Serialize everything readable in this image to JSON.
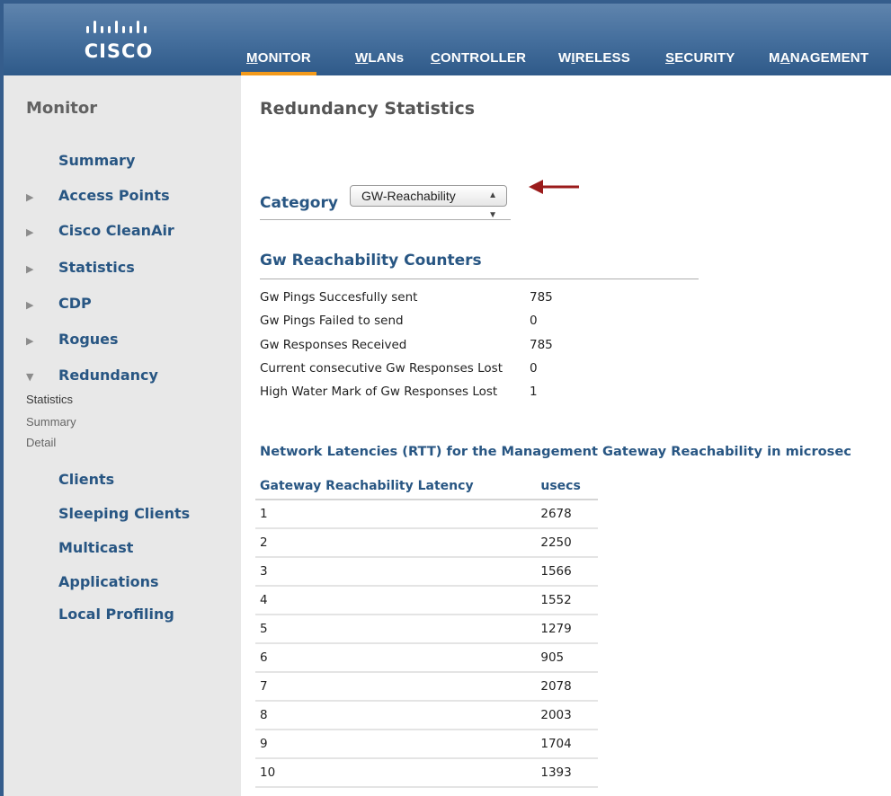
{
  "brand": {
    "logo_text": "CISCO"
  },
  "topnav": {
    "tabs": [
      {
        "pre": "",
        "u": "M",
        "post": "ONITOR",
        "active": true
      },
      {
        "pre": "",
        "u": "W",
        "post": "LANs",
        "active": false
      },
      {
        "pre": "",
        "u": "C",
        "post": "ONTROLLER",
        "active": false
      },
      {
        "pre": "W",
        "u": "I",
        "post": "RELESS",
        "active": false
      },
      {
        "pre": "",
        "u": "S",
        "post": "ECURITY",
        "active": false
      },
      {
        "pre": "M",
        "u": "A",
        "post": "NAGEMENT",
        "active": false
      }
    ]
  },
  "sidebar": {
    "title": "Monitor",
    "items": [
      {
        "label": "Summary",
        "caret": ""
      },
      {
        "label": "Access Points",
        "caret": "▶"
      },
      {
        "label": "Cisco CleanAir",
        "caret": "▶"
      },
      {
        "label": "Statistics",
        "caret": "▶"
      },
      {
        "label": "CDP",
        "caret": "▶"
      },
      {
        "label": "Rogues",
        "caret": "▶"
      },
      {
        "label": "Redundancy",
        "caret": "▼"
      },
      {
        "label": "Clients",
        "caret": ""
      },
      {
        "label": "Sleeping Clients",
        "caret": ""
      },
      {
        "label": "Multicast",
        "caret": ""
      },
      {
        "label": "Applications",
        "caret": ""
      },
      {
        "label": "Local Profiling",
        "caret": ""
      }
    ],
    "subitems": [
      "Statistics",
      "Summary",
      "Detail"
    ]
  },
  "main": {
    "title": "Redundancy Statistics",
    "category_label": "Category",
    "category_value": "GW-Reachability",
    "counters_title": "Gw Reachability Counters",
    "counters": [
      {
        "label": "Gw Pings Succesfully sent",
        "value": "785"
      },
      {
        "label": "Gw Pings Failed to send",
        "value": "0"
      },
      {
        "label": "Gw Responses Received",
        "value": "785"
      },
      {
        "label": "Current consecutive Gw Responses Lost",
        "value": "0"
      },
      {
        "label": "High Water Mark of Gw Responses Lost",
        "value": "1"
      }
    ],
    "latency_title": "Network Latencies (RTT) for the Management Gateway Reachability in microsec",
    "latency_table": {
      "headers": [
        "Gateway Reachability Latency",
        "usecs"
      ],
      "rows": [
        [
          "1",
          "2678"
        ],
        [
          "2",
          "2250"
        ],
        [
          "3",
          "1566"
        ],
        [
          "4",
          "1552"
        ],
        [
          "5",
          "1279"
        ],
        [
          "6",
          "905"
        ],
        [
          "7",
          "2078"
        ],
        [
          "8",
          "2003"
        ],
        [
          "9",
          "1704"
        ],
        [
          "10",
          "1393"
        ]
      ]
    }
  },
  "colors": {
    "header_blue": "#456f9d",
    "active_tab_underline": "#f39a1b",
    "link_blue": "#285683",
    "sidebar_bg": "#e8e8e8",
    "annotation_arrow": "#9b1b1b"
  },
  "icons": {
    "logo": "cisco-bridge-bars",
    "collapsed": "triangle-right",
    "expanded": "triangle-down",
    "select": "up-down-arrows",
    "annotation": "red-arrow-left"
  }
}
